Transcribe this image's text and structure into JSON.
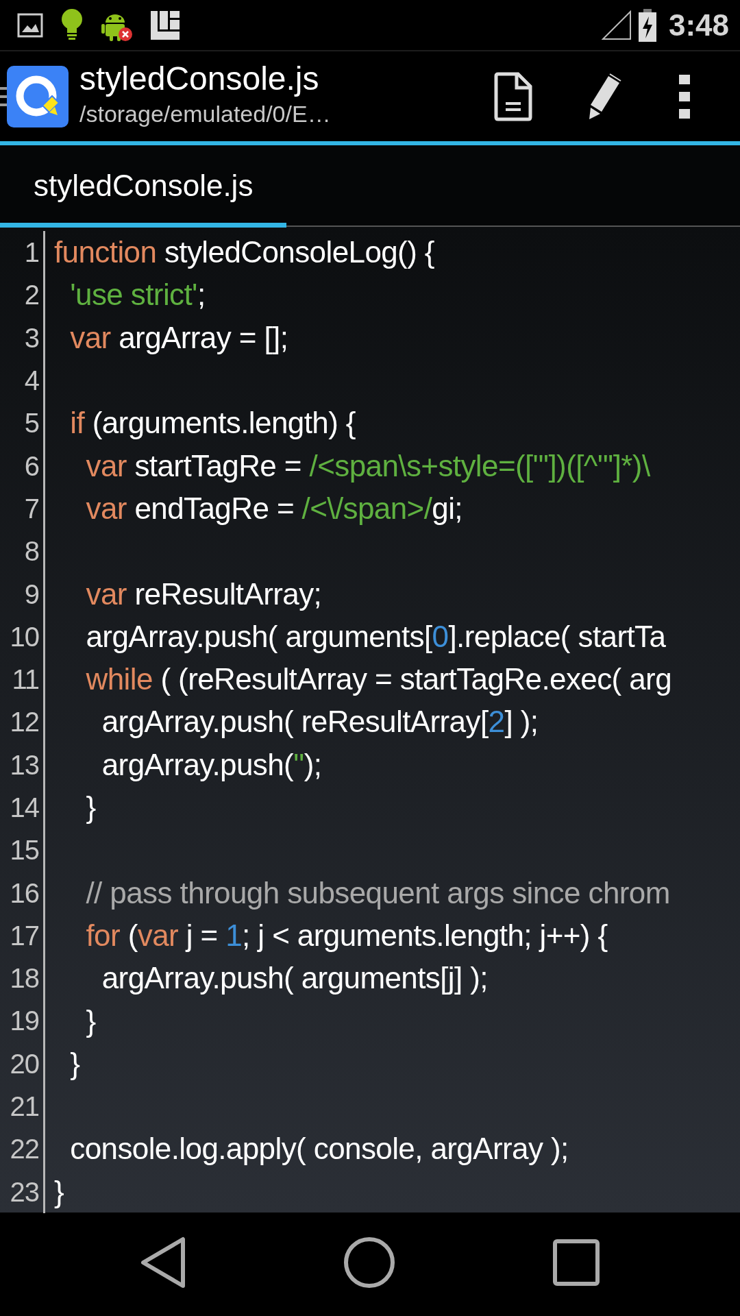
{
  "status_bar": {
    "time": "3:48"
  },
  "toolbar": {
    "title": "styledConsole.js",
    "subtitle": "/storage/emulated/0/E…"
  },
  "tabs": [
    {
      "label": "styledConsole.js",
      "selected": true
    }
  ],
  "editor": {
    "lines": [
      {
        "number": "1",
        "tokens": [
          {
            "kind": "keyword",
            "text": "function"
          },
          {
            "kind": "plain",
            "text": " styledConsoleLog() {"
          }
        ]
      },
      {
        "number": "2",
        "tokens": [
          {
            "kind": "string",
            "text": "  'use strict'"
          },
          {
            "kind": "plain",
            "text": ";"
          }
        ]
      },
      {
        "number": "3",
        "tokens": [
          {
            "kind": "keyword",
            "text": "  var"
          },
          {
            "kind": "plain",
            "text": " argArray = [];"
          }
        ]
      },
      {
        "number": "4"
      },
      {
        "number": "5",
        "tokens": [
          {
            "kind": "keyword",
            "text": "  if"
          },
          {
            "kind": "plain",
            "text": " (arguments.length) {"
          }
        ]
      },
      {
        "number": "6",
        "tokens": [
          {
            "kind": "keyword",
            "text": "    var"
          },
          {
            "kind": "plain",
            "text": " startTagRe = "
          },
          {
            "kind": "string",
            "text": "/<span\\s+style=([\"'])([^\"']*)\\"
          }
        ]
      },
      {
        "number": "7",
        "tokens": [
          {
            "kind": "keyword",
            "text": "    var"
          },
          {
            "kind": "plain",
            "text": " endTagRe = "
          },
          {
            "kind": "string",
            "text": "/<\\/span>/"
          },
          {
            "kind": "plain",
            "text": "gi;"
          }
        ]
      },
      {
        "number": "8"
      },
      {
        "number": "9",
        "tokens": [
          {
            "kind": "keyword",
            "text": "    var"
          },
          {
            "kind": "plain",
            "text": " reResultArray;"
          }
        ]
      },
      {
        "number": "10",
        "tokens": [
          {
            "kind": "plain",
            "text": "    argArray.push( arguments["
          },
          {
            "kind": "number",
            "text": "0"
          },
          {
            "kind": "plain",
            "text": "].replace( startTa"
          }
        ]
      },
      {
        "number": "11",
        "tokens": [
          {
            "kind": "keyword",
            "text": "    while"
          },
          {
            "kind": "plain",
            "text": " ( (reResultArray = startTagRe.exec( arg"
          }
        ]
      },
      {
        "number": "12",
        "tokens": [
          {
            "kind": "plain",
            "text": "      argArray.push( reResultArray["
          },
          {
            "kind": "number",
            "text": "2"
          },
          {
            "kind": "plain",
            "text": "] );"
          }
        ]
      },
      {
        "number": "13",
        "tokens": [
          {
            "kind": "plain",
            "text": "      argArray.push("
          },
          {
            "kind": "string",
            "text": "''"
          },
          {
            "kind": "plain",
            "text": ");"
          }
        ]
      },
      {
        "number": "14",
        "tokens": [
          {
            "kind": "plain",
            "text": "    }"
          }
        ]
      },
      {
        "number": "15"
      },
      {
        "number": "16",
        "tokens": [
          {
            "kind": "comment",
            "text": "    // pass through subsequent args since chrom"
          }
        ]
      },
      {
        "number": "17",
        "tokens": [
          {
            "kind": "keyword",
            "text": "    for"
          },
          {
            "kind": "plain",
            "text": " ("
          },
          {
            "kind": "keyword",
            "text": "var"
          },
          {
            "kind": "plain",
            "text": " j = "
          },
          {
            "kind": "number",
            "text": "1"
          },
          {
            "kind": "plain",
            "text": "; j < arguments.length; j++) {"
          }
        ]
      },
      {
        "number": "18",
        "tokens": [
          {
            "kind": "plain",
            "text": "      argArray.push( arguments[j] );"
          }
        ]
      },
      {
        "number": "19",
        "tokens": [
          {
            "kind": "plain",
            "text": "    }"
          }
        ]
      },
      {
        "number": "20",
        "tokens": [
          {
            "kind": "plain",
            "text": "  }"
          }
        ]
      },
      {
        "number": "21"
      },
      {
        "number": "22",
        "tokens": [
          {
            "kind": "plain",
            "text": "  console.log.apply( console, argArray );"
          }
        ]
      },
      {
        "number": "23",
        "tokens": [
          {
            "kind": "plain",
            "text": "}"
          }
        ]
      }
    ]
  }
}
